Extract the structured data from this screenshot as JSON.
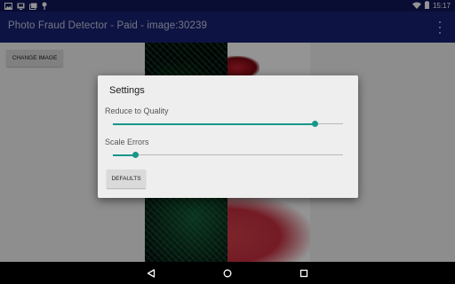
{
  "status_bar": {
    "time": "15:17",
    "left_icons": [
      "image-icon",
      "screenshot-icon",
      "gallery-icon",
      "notification-pin-icon"
    ],
    "right_icons": [
      "wifi-icon",
      "battery-icon"
    ]
  },
  "app_bar": {
    "title": "Photo Fraud Detector - Paid - image:30239",
    "overflow_icon": "more-vert-icon"
  },
  "content": {
    "change_image_label": "CHANGE IMAGE"
  },
  "dialog": {
    "title": "Settings",
    "sliders": [
      {
        "label": "Reduce to Quality",
        "value": 0.88
      },
      {
        "label": "Scale Errors",
        "value": 0.1
      }
    ],
    "defaults_label": "DEFAULTS"
  },
  "colors": {
    "status_bar": "#10185a",
    "app_bar": "#172273",
    "accent": "#17968a",
    "dialog_bg": "#eeeeee"
  },
  "nav_bar": {
    "icons": [
      "back-icon",
      "home-icon",
      "recents-icon"
    ]
  }
}
